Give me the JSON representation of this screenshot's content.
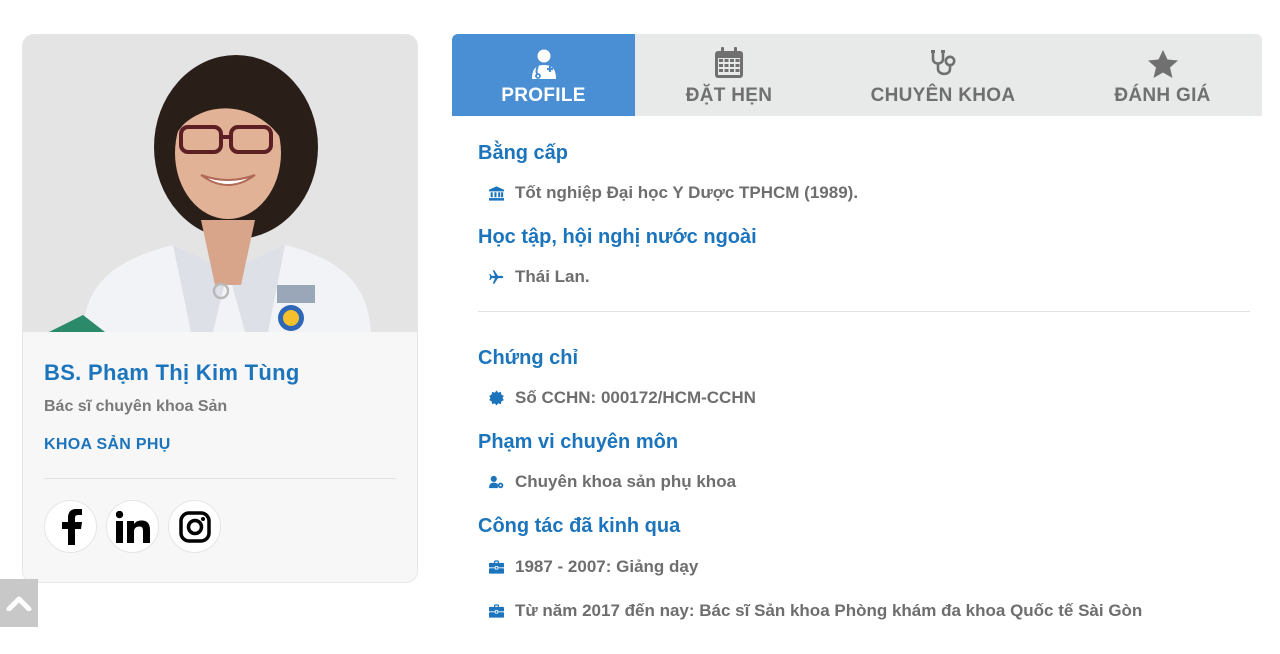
{
  "doctor": {
    "name": "BS. Phạm Thị Kim Tùng",
    "title": "Bác sĩ chuyên khoa Sản",
    "department": "KHOA SẢN PHỤ"
  },
  "tabs": [
    {
      "label": "PROFILE",
      "icon": "user-doctor-icon",
      "active": true
    },
    {
      "label": "ĐẶT HẸN",
      "icon": "calendar-icon",
      "active": false
    },
    {
      "label": "CHUYÊN KHOA",
      "icon": "stethoscope-icon",
      "active": false
    },
    {
      "label": "ĐÁNH GIÁ",
      "icon": "star-icon",
      "active": false
    }
  ],
  "sections": {
    "degree": {
      "title": "Bằng cấp",
      "items": [
        {
          "icon": "university-icon",
          "text": "Tốt nghiệp Đại học Y Dược TPHCM (1989)."
        }
      ]
    },
    "abroad": {
      "title": "Học tập, hội nghị nước ngoài",
      "items": [
        {
          "icon": "plane-icon",
          "text": "Thái Lan."
        }
      ]
    },
    "certificate": {
      "title": "Chứng chỉ",
      "items": [
        {
          "icon": "certificate-icon",
          "text": "Số CCHN: 000172/HCM-CCHN"
        }
      ]
    },
    "scope": {
      "title": "Phạm vi chuyên môn",
      "items": [
        {
          "icon": "user-cog-icon",
          "text": "Chuyên khoa sản phụ khoa"
        }
      ]
    },
    "work": {
      "title": "Công tác đã kinh qua",
      "items": [
        {
          "icon": "briefcase-icon",
          "text": "1987 - 2007: Giảng dạy"
        },
        {
          "icon": "briefcase-icon",
          "text": "Từ năm 2017 đến nay: Bác sĩ Sản khoa Phòng khám đa khoa Quốc tế Sài Gòn"
        }
      ]
    }
  },
  "socials": [
    {
      "name": "facebook",
      "icon": "facebook-icon"
    },
    {
      "name": "linkedin",
      "icon": "linkedin-icon"
    },
    {
      "name": "instagram",
      "icon": "instagram-icon"
    }
  ],
  "colors": {
    "accent": "#1c75bc",
    "tab_active": "#4a8fd4",
    "tab_bg": "#e8eaea",
    "text": "#6e6e6e"
  }
}
